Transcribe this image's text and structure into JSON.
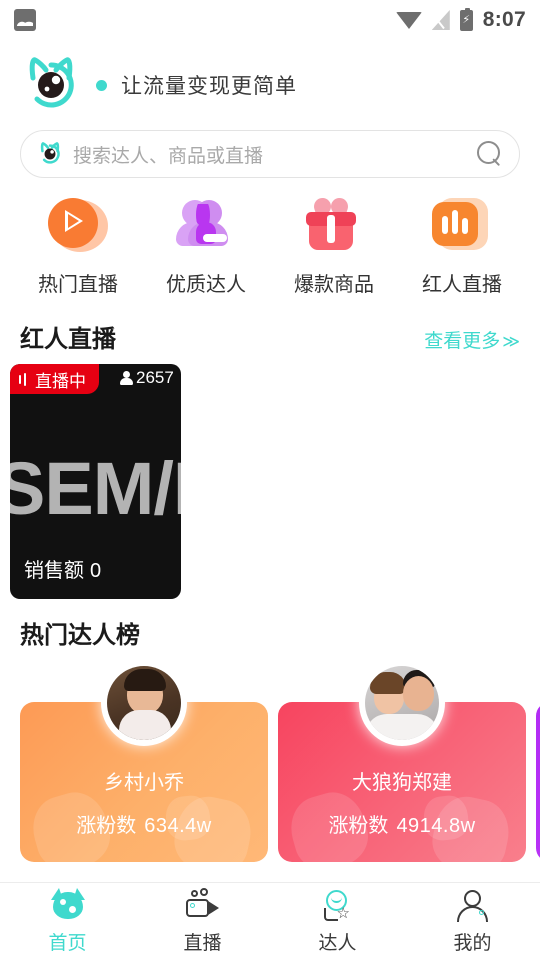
{
  "status_bar": {
    "notification_icon": "photo-icon",
    "wifi_icon": "wifi-icon",
    "signal_icon": "signal-off-icon",
    "battery_icon": "battery-charging-icon",
    "time": "8:07"
  },
  "brand": {
    "logo_icon": "cat-logo-icon",
    "dot": "",
    "slogan": "让流量变现更简单"
  },
  "search": {
    "logo_icon": "cat-logo-small-icon",
    "placeholder": "搜索达人、商品或直播",
    "search_icon": "search-icon"
  },
  "categories": [
    {
      "icon": "play-icon",
      "label": "热门直播"
    },
    {
      "icon": "people-icon",
      "label": "优质达人"
    },
    {
      "icon": "gift-icon",
      "label": "爆款商品"
    },
    {
      "icon": "bar-chart-icon",
      "label": "红人直播"
    }
  ],
  "live_section": {
    "title": "红人直播",
    "more_label": "查看更多",
    "more_chevron": "≫",
    "cards": [
      {
        "badge_icon": "broadcast-icon",
        "badge_label": "直播中",
        "viewers_icon": "person-icon",
        "viewers": "2657",
        "cover_text": "SEM/R",
        "sales_label": "销售额",
        "sales_value": "0"
      }
    ]
  },
  "rank_section": {
    "title": "热门达人榜",
    "cards": [
      {
        "avatar": "avatar-xiangcunxiaoqiao",
        "name": "乡村小乔",
        "stat_label": "涨粉数",
        "stat_value": "634.4w",
        "color": "#fd9a55"
      },
      {
        "avatar": "avatar-dalanggouzhengjian",
        "name": "大狼狗郑建",
        "stat_label": "涨粉数",
        "stat_value": "4914.8w",
        "color": "#f7445f"
      },
      {
        "avatar": "avatar-third",
        "name": "",
        "stat_label": "",
        "stat_value": "",
        "color": "#b22cf5"
      }
    ]
  },
  "tabbar": {
    "items": [
      {
        "icon": "cat-home-icon",
        "label": "首页",
        "active": true
      },
      {
        "icon": "video-camera-icon",
        "label": "直播",
        "active": false
      },
      {
        "icon": "star-person-icon",
        "label": "达人",
        "active": false
      },
      {
        "icon": "person-icon",
        "label": "我的",
        "active": false
      }
    ]
  },
  "theme": {
    "accent": "#3fd9cd",
    "live_red": "#e60012",
    "text_dark": "#1b1b1b"
  }
}
